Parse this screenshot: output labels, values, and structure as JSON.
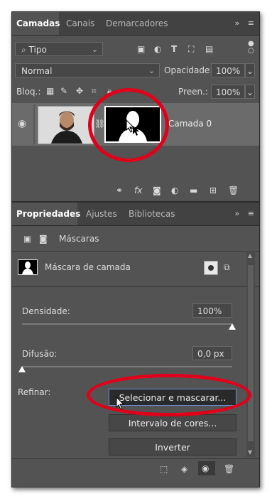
{
  "layers_panel": {
    "tabs": [
      "Camadas",
      "Canais",
      "Demarcadores"
    ],
    "filter_kind": "Tipo",
    "blend_mode": "Normal",
    "opacity_label": "Opacidade:",
    "opacity_value": "100%",
    "lock_label": "Bloq.:",
    "fill_label": "Preen.:",
    "fill_value": "100%",
    "layer_name": "Camada 0"
  },
  "properties_panel": {
    "tabs": [
      "Propriedades",
      "Ajustes",
      "Bibliotecas"
    ],
    "section_title": "Máscaras",
    "mask_type": "Máscara de camada",
    "density_label": "Densidade:",
    "density_value": "100%",
    "density_fraction": 1.0,
    "feather_label": "Difusão:",
    "feather_value": "0,0 px",
    "feather_fraction": 0.0,
    "refine_label": "Refinar:",
    "buttons": {
      "select_and_mask": "Selecionar e mascarar...",
      "color_range": "Intervalo de cores...",
      "invert": "Inverter"
    }
  },
  "colors": {
    "panel_bg": "#535353",
    "tabbar_bg": "#424242",
    "highlight_ring": "#e0001a",
    "button_focus": "#6c8fd4"
  },
  "icons": [
    "menu-icon",
    "collapse-icon",
    "search-icon",
    "eye-icon",
    "link-icon",
    "trash-icon",
    "fx-icon",
    "folder-icon",
    "new-layer-icon",
    "mask-icon",
    "adjustment-icon",
    "cursor-icon"
  ]
}
